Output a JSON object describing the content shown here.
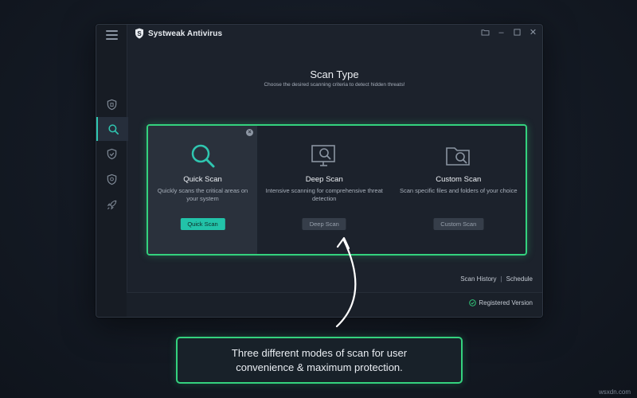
{
  "app": {
    "title": "Systweak Antivirus",
    "accent_color": "#2fc6b0",
    "highlight_color": "#34d27e",
    "window_controls": [
      "minimize-icon",
      "maximize-icon",
      "close-icon"
    ]
  },
  "sidebar": {
    "items": [
      {
        "name": "shield-home-icon",
        "active": false
      },
      {
        "name": "search-icon",
        "active": true
      },
      {
        "name": "shield-check-icon",
        "active": false
      },
      {
        "name": "shield-icon",
        "active": false
      },
      {
        "name": "rocket-icon",
        "active": false
      }
    ]
  },
  "main": {
    "heading": "Scan Type",
    "subheading": "Choose the desired scanning criteria to detect hidden threats!",
    "cards": [
      {
        "title": "Quick Scan",
        "desc": "Quickly scans the critical areas on your system",
        "button": "Quick Scan",
        "icon": "magnifier-icon"
      },
      {
        "title": "Deep Scan",
        "desc": "Intensive scanning for comprehensive threat detection",
        "button": "Deep Scan",
        "icon": "monitor-search-icon"
      },
      {
        "title": "Custom Scan",
        "desc": "Scan specific files and folders of your choice",
        "button": "Custom Scan",
        "icon": "folder-search-icon"
      }
    ],
    "links": {
      "history": "Scan History",
      "separator": "|",
      "schedule": "Schedule"
    },
    "status": "Registered Version"
  },
  "callout": {
    "text": "Three different modes of scan for user convenience & maximum protection."
  },
  "watermark": "wsxdn.com"
}
